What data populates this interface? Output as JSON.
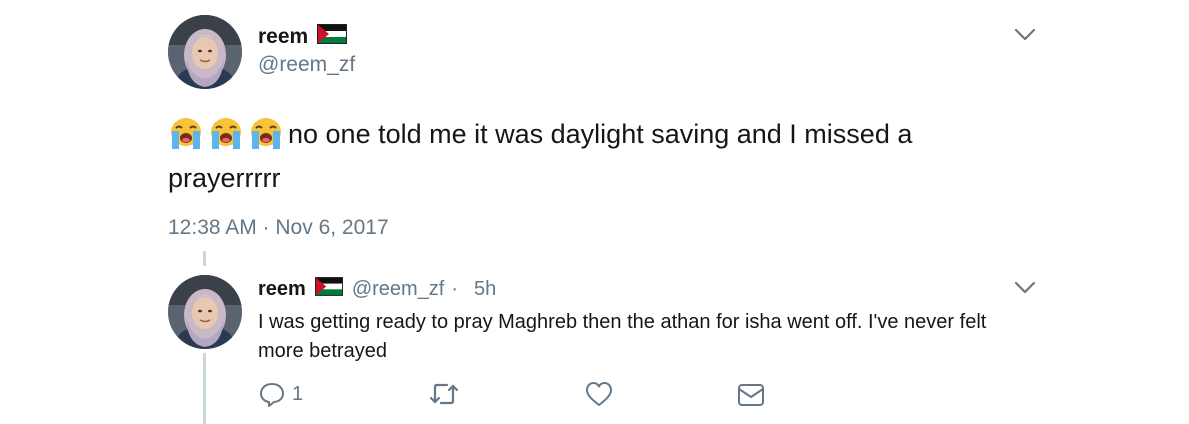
{
  "tweet": {
    "display_name": "reem",
    "handle": "@reem_zf",
    "text": "no one told me it was daylight saving and I missed a prayerrrrr",
    "emojis": [
      "loudly-crying-face",
      "loudly-crying-face",
      "loudly-crying-face"
    ],
    "timestamp": "12:38 AM · Nov 6, 2017"
  },
  "reply": {
    "display_name": "reem",
    "handle": "@reem_zf",
    "separator": "·",
    "age": "5h",
    "text": "I was getting ready to pray Maghreb then the athan for isha went off. I've never felt more betrayed",
    "reply_count": "1",
    "icons": {
      "reply": "comment-icon",
      "retweet": "retweet-icon",
      "like": "heart-icon",
      "dm": "envelope-icon"
    }
  },
  "colors": {
    "text": "#14171a",
    "secondary": "#657786",
    "thread_line": "#ccd6dd",
    "flag_red": "#ce1126",
    "flag_green": "#007a3d"
  }
}
